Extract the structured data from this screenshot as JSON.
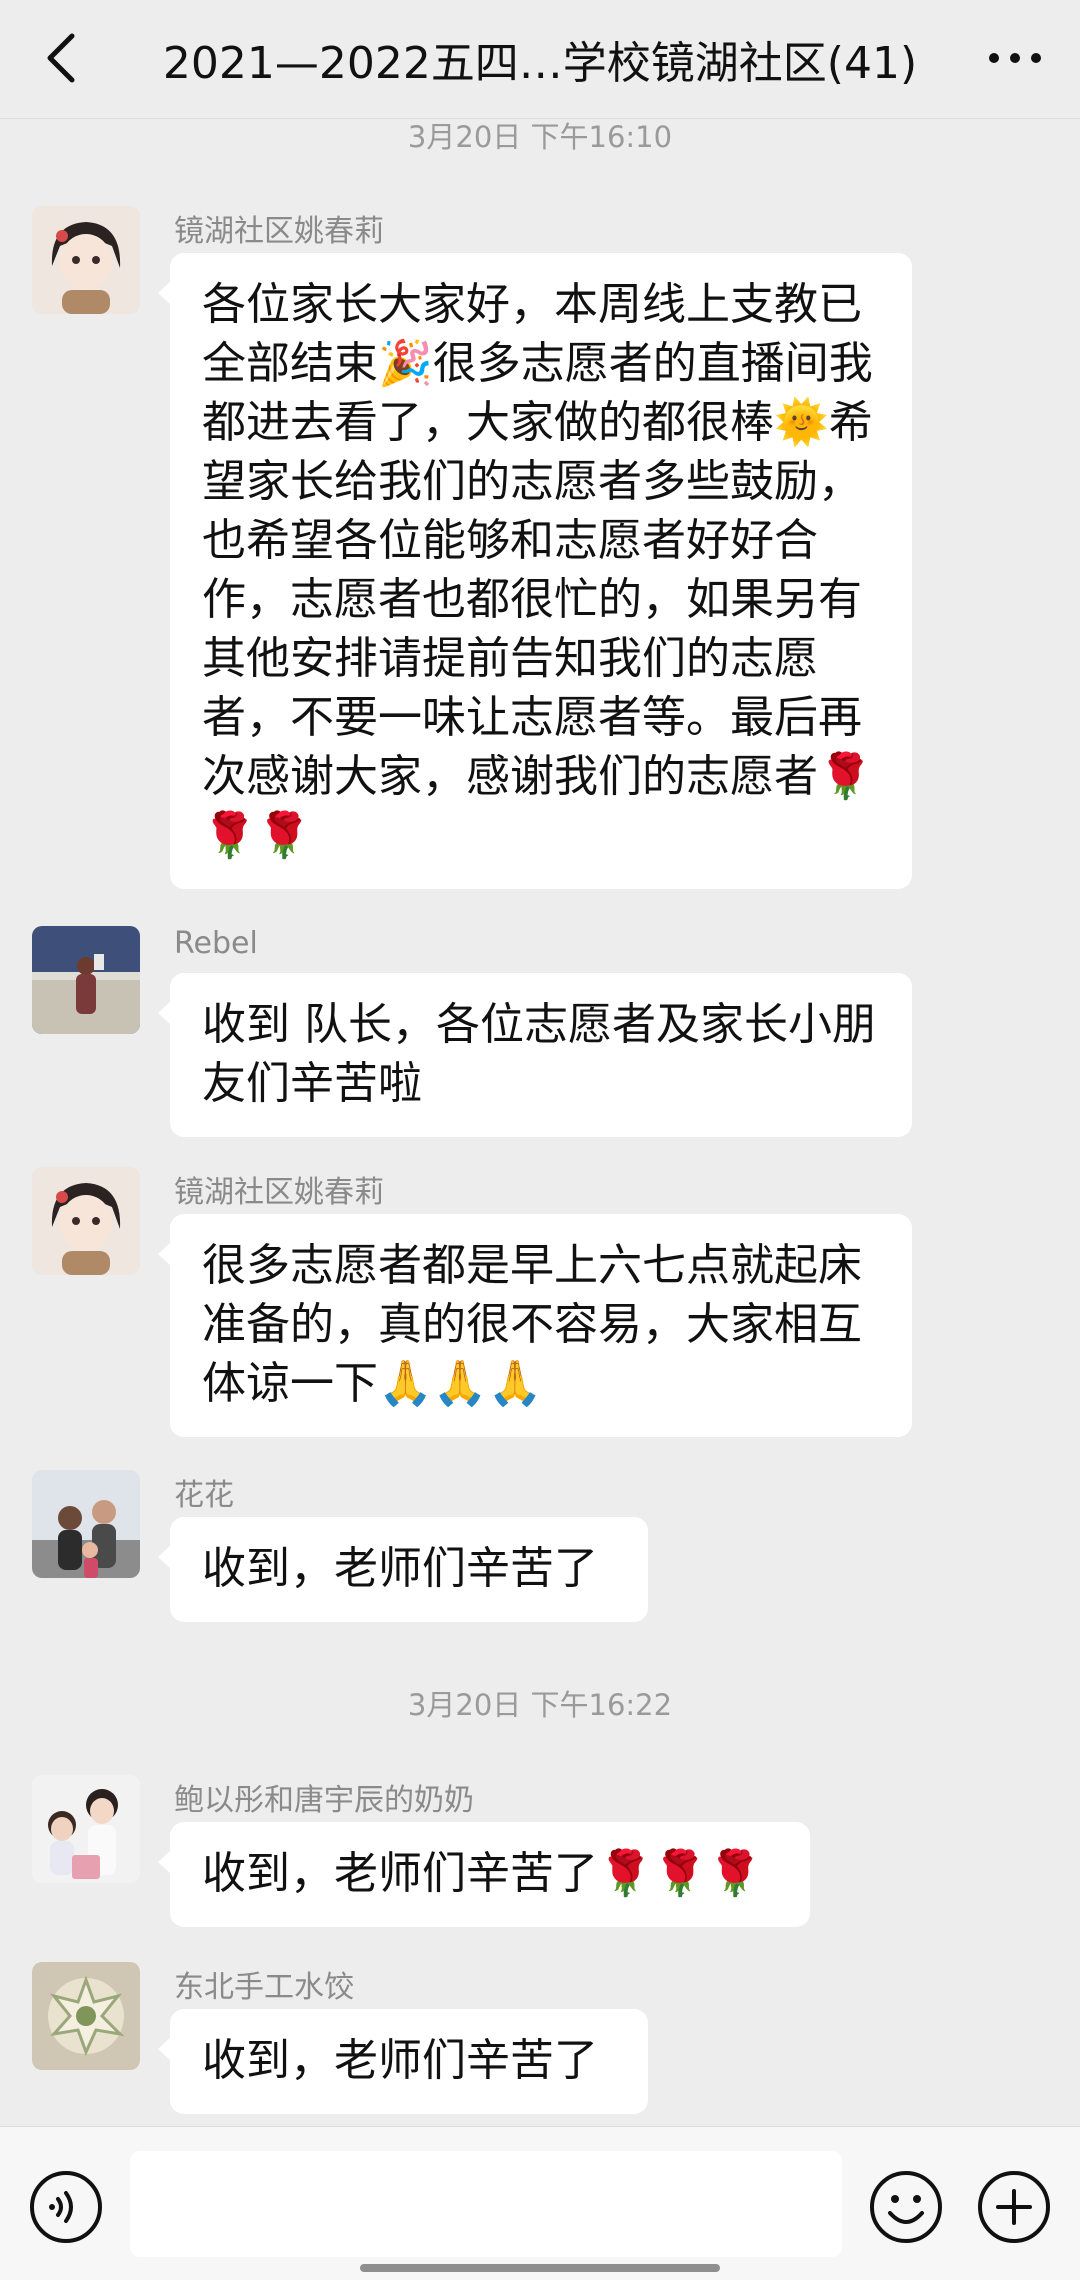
{
  "header": {
    "title": "2021—2022五四…学校镜湖社区(41)"
  },
  "timestamps": {
    "t1": "3月20日 下午16:10",
    "t2": "3月20日 下午16:22"
  },
  "messages": [
    {
      "sender": "镜湖社区姚春莉",
      "text": "各位家长大家好，本周线上支教已全部结束🎉很多志愿者的直播间我都进去看了，大家做的都很棒🌞希望家长给我们的志愿者多些鼓励，也希望各位能够和志愿者好好合作，志愿者也都很忙的，如果另有其他安排请提前告知我们的志愿者，不要一味让志愿者等。最后再次感谢大家，感谢我们的志愿者🌹🌹🌹"
    },
    {
      "sender": "Rebel",
      "text": "收到 队长，各位志愿者及家长小朋友们辛苦啦"
    },
    {
      "sender": "镜湖社区姚春莉",
      "text": "很多志愿者都是早上六七点就起床准备的，真的很不容易，大家相互体谅一下🙏🙏🙏"
    },
    {
      "sender": "花花",
      "text": "收到，老师们辛苦了"
    },
    {
      "sender": "鲍以彤和唐宇辰的奶奶",
      "text": "收到，老师们辛苦了🌹🌹🌹"
    },
    {
      "sender": "东北手工水饺",
      "text": "收到，老师们辛苦了"
    }
  ],
  "input": {
    "value": ""
  },
  "icons": {
    "back": "chevron-left-icon",
    "more": "more-dots-icon",
    "voice": "voice-icon",
    "emoji": "emoji-icon",
    "plus": "plus-icon"
  },
  "colors": {
    "background": "#ededed",
    "bubble": "#ffffff",
    "sender": "#8a8a8a",
    "timestamp": "#9a9a9a"
  }
}
